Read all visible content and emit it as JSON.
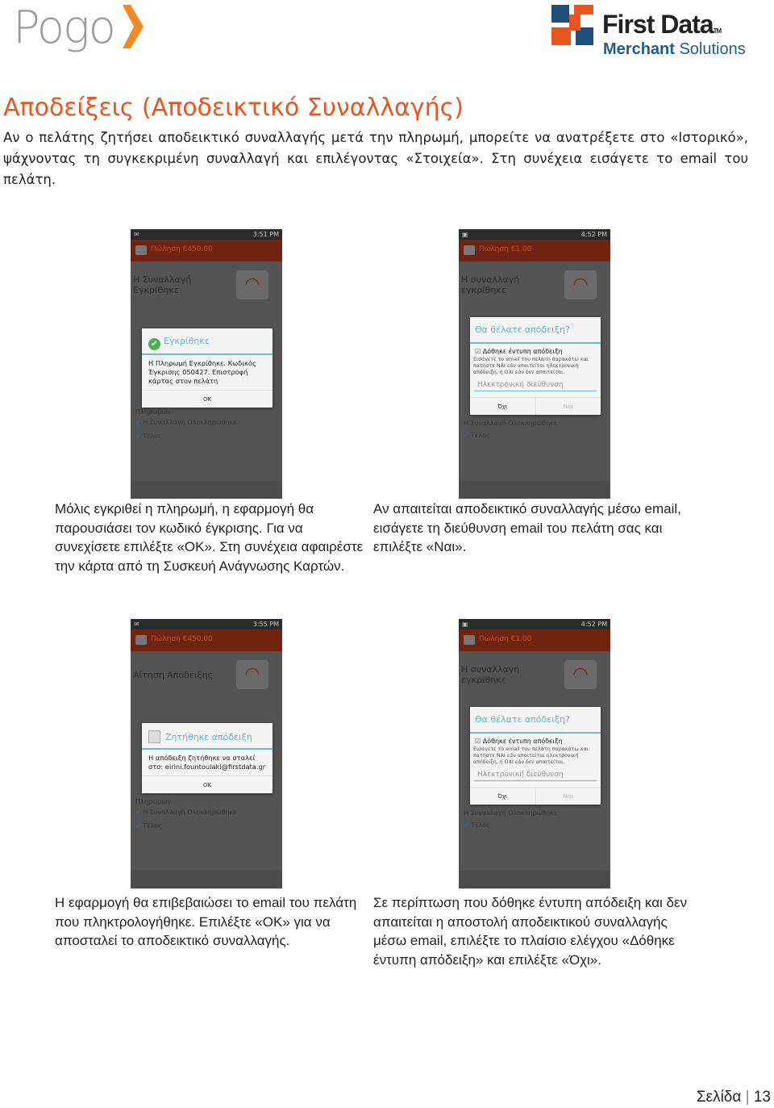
{
  "header": {
    "left_logo": "Pogo",
    "right_logo_name": "First Data",
    "right_logo_tm": "TM",
    "right_logo_sub_bold": "Merchant",
    "right_logo_sub": "Solutions"
  },
  "title": "Αποδείξεις (Αποδεικτικό Συναλλαγής)",
  "intro": "Αν ο πελάτης ζητήσει αποδεικτικό συναλλαγής μετά την πληρωμή, μπορείτε να ανατρέξετε στο «Ιστορικό», ψάχνοντας τη συγκεκριμένη συναλλαγή και επιλέγοντας «Στοιχεία». Στη συνέχεια εισάγετε το email του πελάτη.",
  "phones": [
    {
      "time": "3:51 PM",
      "header": "Πώληση €450.00",
      "title": "Η Συναλλαγή Εγκρίθηκε",
      "dialog_title": "Εγκρίθηκε",
      "dialog_body": "Η Πληρωμή Εγκρίθηκε. Κωδικός Έγκρισης 050427. Επιστροφή κάρτας στον πελάτη",
      "ok": "OK",
      "steps": [
        "Πληρωμών",
        "Η Συναλλαγή Ολοκληρώθηκε",
        "Τέλος"
      ]
    },
    {
      "time": "4:52 PM",
      "header": "Πώληση €1.00",
      "title": "Η συναλλαγή εγκρίθηκε",
      "dialog_title": "Θα θέλατε απόδειξη?",
      "checkbox": "Δόθηκε έντυπη απόδειξη",
      "note": "Εισάγετε το email του πελάτη παρακάτω και πατήστε ΝΑΙ εάν απαιτείται ηλεκτρονική απόδειξη, ή ΟΧΙ εάν δεν απαιτείται.",
      "email_placeholder": "Ηλεκτρονική διεύθυνση",
      "no": "Όχι",
      "yes": "Ναι",
      "steps": [
        "Η Συναλλαγή Ολοκληρώθηκε",
        "Τέλος"
      ]
    },
    {
      "time": "3:55 PM",
      "header": "Πώληση €450.00",
      "title": "Αίτηση Απόδειξης",
      "dialog_title": "Ζητήθηκε απόδειξη",
      "dialog_body": "Η απόδειξη ζητήθηκε να σταλεί στο: eirini.fountoulaki@firstdata.gr",
      "ok": "OK",
      "steps": [
        "Πληρωμών",
        "Η Συναλλαγή Ολοκληρώθηκε",
        "Τέλος"
      ]
    },
    {
      "time": "4:52 PM",
      "header": "Πώληση €1.00",
      "title": "Η συναλλαγή εγκρίθηκε",
      "dialog_title": "Θα θέλατε απόδειξη?",
      "checkbox": "Δόθηκε έντυπη απόδειξη",
      "note": "Εισάγετε το email του πελάτη παρακάτω και πατήστε ΝΑΙ εάν απαιτείται ηλεκτρονική απόδειξη, ή ΟΧΙ εάν δεν απαιτείται.",
      "email_placeholder": "Ηλεκτρονική διεύθυνση",
      "no": "Όχι",
      "yes": "Ναι",
      "steps": [
        "Η Συναλλαγή Ολοκληρώθηκε",
        "Τέλος"
      ]
    }
  ],
  "captions": [
    "Μόλις εγκριθεί η πληρωμή, η εφαρμογή θα παρουσιάσει τον κωδικό έγκρισης. Για να συνεχίσετε επιλέξτε «ΟΚ». Στη συνέχεια αφαιρέστε την κάρτα από τη Συσκευή Ανάγνωσης Καρτών.",
    "Αν απαιτείται αποδεικτικό συναλλαγής μέσω email, εισάγετε τη διεύθυνση email του πελάτη σας και επιλέξτε «Ναι».",
    "Η εφαρμογή θα επιβεβαιώσει το email του πελάτη που πληκτρολογήθηκε. Επιλέξτε «ΟΚ» για να αποσταλεί το αποδεικτικό συναλλαγής.",
    "Σε περίπτωση που δόθηκε έντυπη απόδειξη και δεν απαιτείται η αποστολή αποδεικτικού συναλλαγής μέσω email, επιλέξτε το πλαίσιο ελέγχου «Δόθηκε έντυπη απόδειξη» και επιλέξτε «Όχι»."
  ],
  "footer": {
    "page_label": "Σελίδα",
    "page_number": "13"
  },
  "colors": {
    "title": "#e8561f",
    "brand_blue": "#1f5d8c",
    "dialog_accent": "#5fb3cc"
  }
}
